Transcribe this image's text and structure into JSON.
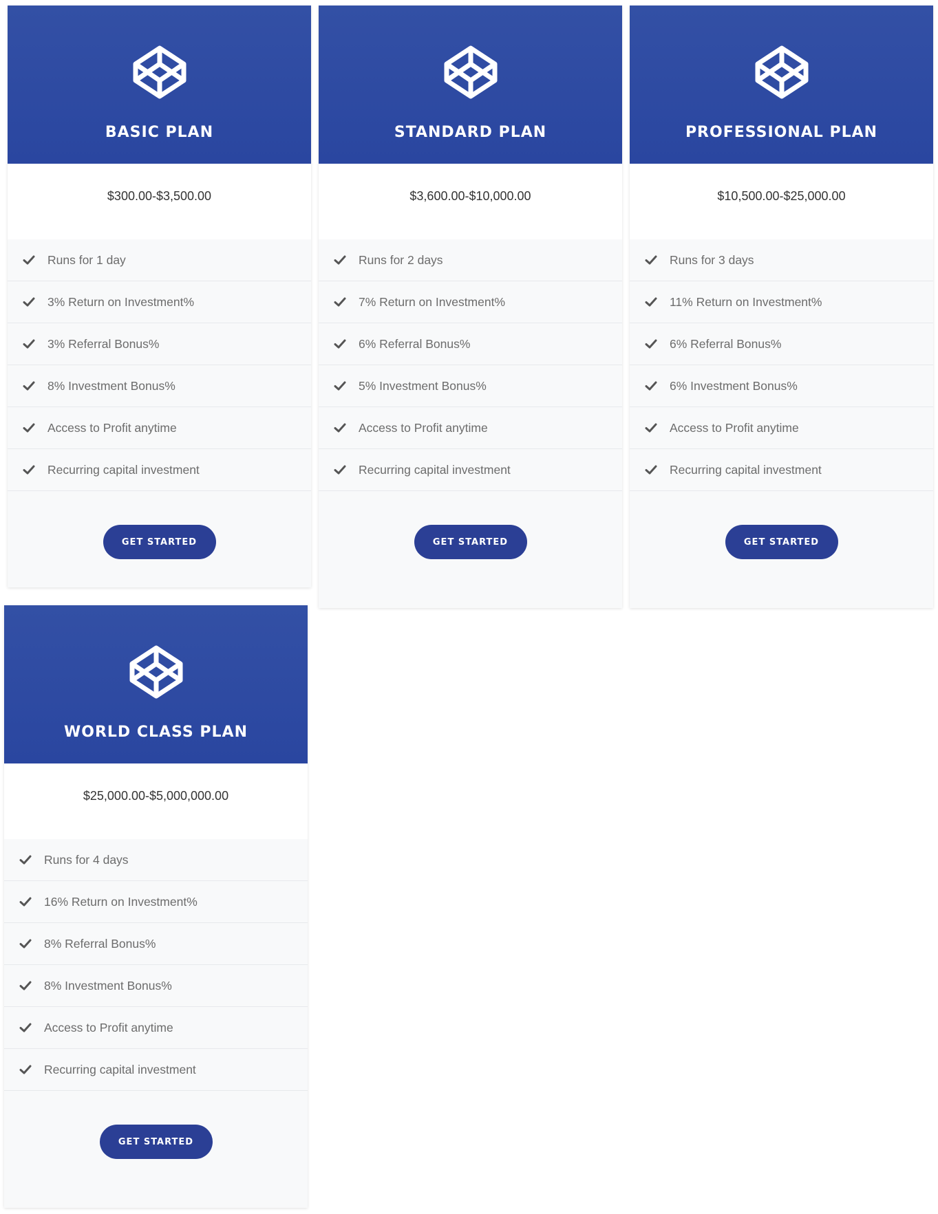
{
  "plans": [
    {
      "title": "BASIC PLAN",
      "icon": "codepen-cube-icon",
      "price": "$300.00-$3,500.00",
      "features": [
        "Runs for 1 day",
        "3% Return on Investment%",
        "3% Referral Bonus%",
        "8% Investment Bonus%",
        "Access to Profit anytime",
        "Recurring capital investment"
      ],
      "button": "GET STARTED"
    },
    {
      "title": "STANDARD PLAN",
      "icon": "codepen-cube-icon",
      "price": "$3,600.00-$10,000.00",
      "features": [
        "Runs for 2 days",
        "7% Return on Investment%",
        "6% Referral Bonus%",
        "5% Investment Bonus%",
        "Access to Profit anytime",
        "Recurring capital investment"
      ],
      "button": "GET STARTED"
    },
    {
      "title": "PROFESSIONAL PLAN",
      "icon": "codepen-cube-icon",
      "price": "$10,500.00-$25,000.00",
      "features": [
        "Runs for 3 days",
        "11% Return on Investment%",
        "6% Referral Bonus%",
        "6% Investment Bonus%",
        "Access to Profit anytime",
        "Recurring capital investment"
      ],
      "button": "GET STARTED"
    },
    {
      "title": "WORLD CLASS PLAN",
      "icon": "codepen-cube-icon",
      "price": "$25,000.00-$5,000,000.00",
      "features": [
        "Runs for 4 days",
        "16% Return on Investment%",
        "8% Referral Bonus%",
        "8% Investment Bonus%",
        "Access to Profit anytime",
        "Recurring capital investment"
      ],
      "button": "GET STARTED"
    }
  ],
  "colors": {
    "header": "#2f4ba3",
    "button": "#2b3f95",
    "check": "#555555",
    "text": "#6c6c6c"
  }
}
